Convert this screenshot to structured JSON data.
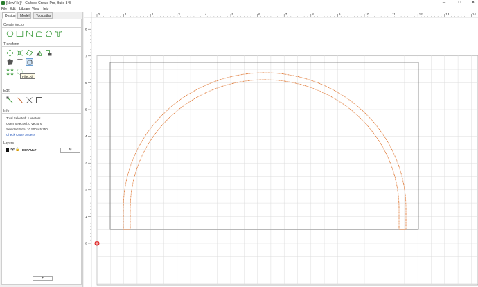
{
  "window": {
    "title": "[NewFile]* - Carbide Create Pro, Build 845",
    "minimize": "─",
    "maximize": "□",
    "close": "✕"
  },
  "menu": [
    "File",
    "Edit",
    "Library",
    "View",
    "Help"
  ],
  "tabs": [
    "Design",
    "Model",
    "Toolpaths"
  ],
  "sections": {
    "create_vector": "Create Vector",
    "transform": "Transform",
    "edit": "Edit",
    "info": "Info",
    "layers": "Layers"
  },
  "tooltip": "Fillet All",
  "info": {
    "total_selected": "Total Selected:  1 Vectors",
    "open_selected": "Open Selected:  0 Vectors",
    "selected_size": "Selected Size:  10.500 x 5.750",
    "check_link": "Check Cutter Access"
  },
  "layer": {
    "name": "DEFAULT",
    "settings_icon": "gear-icon",
    "settings_glyph": "⚙"
  },
  "add_layer": "+",
  "ruler": {
    "h_ticks": [
      "0",
      "1",
      "2",
      "3",
      "4",
      "5",
      "6",
      "7",
      "8",
      "9",
      "10",
      "11",
      "12",
      "13",
      "14"
    ],
    "v_ticks": [
      "0",
      "1",
      "2",
      "3",
      "4",
      "5",
      "6",
      "7",
      "8"
    ]
  },
  "colors": {
    "accent_green": "#3a9a3a",
    "vector_orange": "#e07b39",
    "link_blue": "#2255bb"
  }
}
